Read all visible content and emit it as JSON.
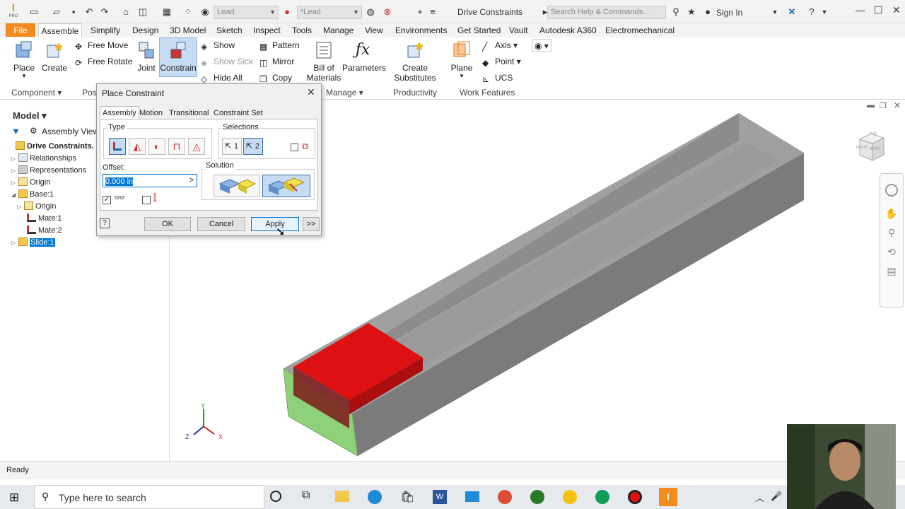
{
  "titlebar": {
    "app_logo": "I",
    "app_badge": "PRO",
    "material_combo": "Lead",
    "appearance_combo": "*Lead",
    "doc_title": "Drive Constraints",
    "search_placeholder": "Search Help & Commands...",
    "sign_in": "Sign In"
  },
  "tabs": [
    "File",
    "Assemble",
    "Simplify",
    "Design",
    "3D Model",
    "Sketch",
    "Inspect",
    "Tools",
    "Manage",
    "View",
    "Environments",
    "Get Started",
    "Vault",
    "Autodesk A360",
    "Electromechanical"
  ],
  "ribbon": {
    "place": "Place",
    "create": "Create",
    "free_move": "Free Move",
    "free_rotate": "Free Rotate",
    "joint": "Joint",
    "constrain": "Constrain",
    "show": "Show",
    "show_sick": "Show Sick",
    "hide_all": "Hide All",
    "pattern": "Pattern",
    "mirror": "Mirror",
    "copy": "Copy",
    "bom_line1": "Bill of",
    "bom_line2": "Materials",
    "parameters": "Parameters",
    "create_subs_line1": "Create",
    "create_subs_line2": "Substitutes",
    "plane": "Plane",
    "axis": "Axis",
    "point": "Point",
    "ucs": "UCS",
    "panel_component": "Component",
    "panel_position": "Posi",
    "panel_manage": "Manage",
    "panel_productivity": "Productivity",
    "panel_work_features": "Work Features"
  },
  "browser": {
    "title": "Model",
    "view": "Assembly View",
    "items": [
      {
        "label": "Drive Constraints.",
        "bold": true
      },
      {
        "label": "Relationships"
      },
      {
        "label": "Representations"
      },
      {
        "label": "Origin"
      },
      {
        "label": "Base:1"
      },
      {
        "label": "Origin"
      },
      {
        "label": "Mate:1"
      },
      {
        "label": "Mate:2"
      },
      {
        "label": "Slide:1",
        "selected": true
      }
    ]
  },
  "dialog": {
    "title": "Place Constraint",
    "tabs": [
      "Assembly",
      "Motion",
      "Transitional",
      "Constraint Set"
    ],
    "type_label": "Type",
    "selections_label": "Selections",
    "sel1": "1",
    "sel2": "2",
    "offset_label": "Offset:",
    "offset_value": "0.000 in",
    "solution_label": "Solution",
    "ok": "OK",
    "cancel": "Cancel",
    "apply": "Apply",
    "more": ">>"
  },
  "viewcube": {
    "top": "TOP",
    "front": "FRONT",
    "right": "RIGHT"
  },
  "status": {
    "text": "Ready"
  },
  "taskbar": {
    "search_placeholder": "Type here to search"
  },
  "colors": {
    "file_tab": "#f28c1e",
    "slide_part": "#dd1111",
    "base_face": "#8fd07a",
    "selection": "#0078d7",
    "rail_top": "#a0a0a0"
  }
}
